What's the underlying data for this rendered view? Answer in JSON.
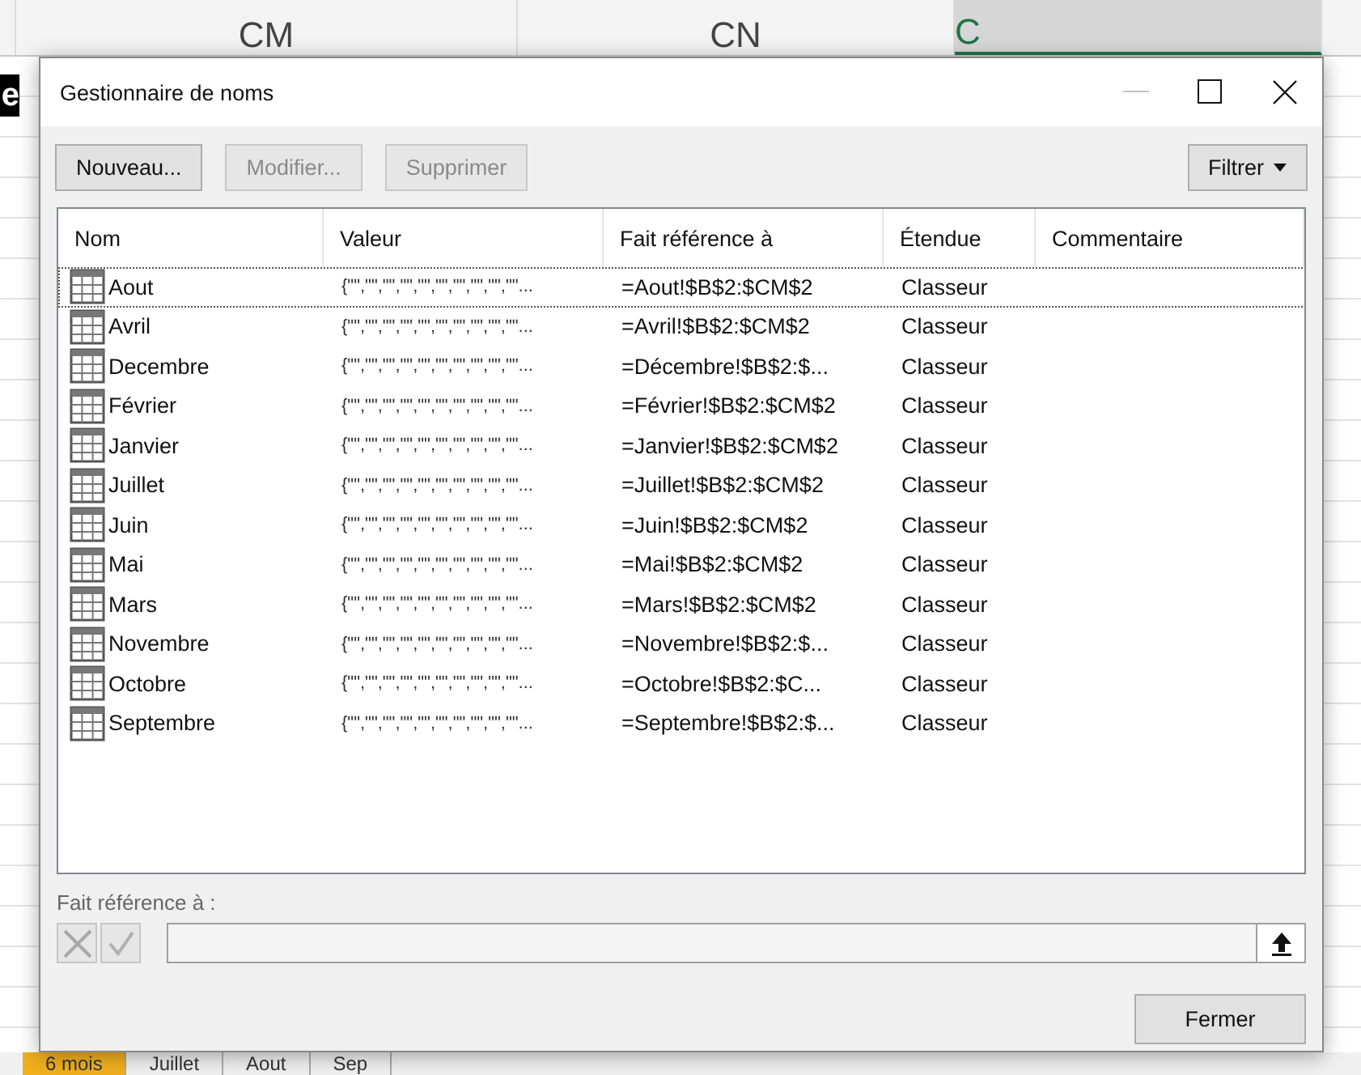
{
  "spreadsheet": {
    "column_headers": [
      {
        "label": "CM",
        "selected": false
      },
      {
        "label": "CN",
        "selected": false
      },
      {
        "label": "C",
        "selected": true
      }
    ],
    "cell_text": "e",
    "sheet_tabs": [
      {
        "label": "6 mois",
        "selected": true
      },
      {
        "label": "Juillet",
        "selected": false
      },
      {
        "label": "Aout",
        "selected": false
      },
      {
        "label": "Sep",
        "selected": false
      }
    ]
  },
  "dialog": {
    "title": "Gestionnaire de noms",
    "buttons": [
      {
        "label": "Nouveau...",
        "disabled": false
      },
      {
        "label": "Modifier...",
        "disabled": true
      },
      {
        "label": "Supprimer",
        "disabled": true
      }
    ],
    "filter_button": "Filtrer",
    "columns": [
      "Nom",
      "Valeur",
      "Fait référence à",
      "Étendue",
      "Commentaire"
    ],
    "rows": [
      {
        "name": "Aout",
        "value": "{\"\",\"\",\"\",\"\",\"\",\"\",\"\",\"\",\"\",\"\"...",
        "refers_to": "=Aout!$B$2:$CM$2",
        "scope": "Classeur",
        "selected": true
      },
      {
        "name": "Avril",
        "value": "{\"\",\"\",\"\",\"\",\"\",\"\",\"\",\"\",\"\",\"\"...",
        "refers_to": "=Avril!$B$2:$CM$2",
        "scope": "Classeur",
        "selected": false
      },
      {
        "name": "Decembre",
        "value": "{\"\",\"\",\"\",\"\",\"\",\"\",\"\",\"\",\"\",\"\"...",
        "refers_to": "=Décembre!$B$2:$...",
        "scope": "Classeur",
        "selected": false
      },
      {
        "name": "Février",
        "value": "{\"\",\"\",\"\",\"\",\"\",\"\",\"\",\"\",\"\",\"\"...",
        "refers_to": "=Février!$B$2:$CM$2",
        "scope": "Classeur",
        "selected": false
      },
      {
        "name": "Janvier",
        "value": "{\"\",\"\",\"\",\"\",\"\",\"\",\"\",\"\",\"\",\"\"...",
        "refers_to": "=Janvier!$B$2:$CM$2",
        "scope": "Classeur",
        "selected": false
      },
      {
        "name": "Juillet",
        "value": "{\"\",\"\",\"\",\"\",\"\",\"\",\"\",\"\",\"\",\"\"...",
        "refers_to": "=Juillet!$B$2:$CM$2",
        "scope": "Classeur",
        "selected": false
      },
      {
        "name": "Juin",
        "value": "{\"\",\"\",\"\",\"\",\"\",\"\",\"\",\"\",\"\",\"\"...",
        "refers_to": "=Juin!$B$2:$CM$2",
        "scope": "Classeur",
        "selected": false
      },
      {
        "name": "Mai",
        "value": "{\"\",\"\",\"\",\"\",\"\",\"\",\"\",\"\",\"\",\"\"...",
        "refers_to": "=Mai!$B$2:$CM$2",
        "scope": "Classeur",
        "selected": false
      },
      {
        "name": "Mars",
        "value": "{\"\",\"\",\"\",\"\",\"\",\"\",\"\",\"\",\"\",\"\"...",
        "refers_to": "=Mars!$B$2:$CM$2",
        "scope": "Classeur",
        "selected": false
      },
      {
        "name": "Novembre",
        "value": "{\"\",\"\",\"\",\"\",\"\",\"\",\"\",\"\",\"\",\"\"...",
        "refers_to": "=Novembre!$B$2:$...",
        "scope": "Classeur",
        "selected": false
      },
      {
        "name": "Octobre",
        "value": "{\"\",\"\",\"\",\"\",\"\",\"\",\"\",\"\",\"\",\"\"...",
        "refers_to": "=Octobre!$B$2:$C...",
        "scope": "Classeur",
        "selected": false
      },
      {
        "name": "Septembre",
        "value": "{\"\",\"\",\"\",\"\",\"\",\"\",\"\",\"\",\"\",\"\"...",
        "refers_to": "=Septembre!$B$2:$...",
        "scope": "Classeur",
        "selected": false
      }
    ],
    "refers_to_label": "Fait référence à :",
    "close_button": "Fermer"
  }
}
